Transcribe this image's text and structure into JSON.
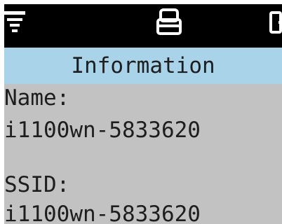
{
  "status_bar": {
    "left_icon": "filter-menu-icon",
    "center_icon": "printer-icon",
    "right_icon": "partial-status-icon"
  },
  "title": "Information",
  "fields": [
    {
      "label": "Name:",
      "value": "i1100wn-5833620"
    },
    {
      "label": "SSID:",
      "value": "i1100wn-5833620"
    }
  ],
  "colors": {
    "status_bar": "#000000",
    "title_bar": "#a9d3e8",
    "background": "#c2c2c2",
    "text": "#1e1e1e"
  }
}
